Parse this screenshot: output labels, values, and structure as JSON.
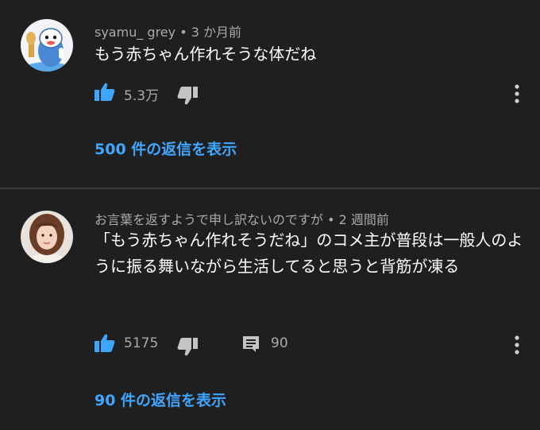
{
  "comments": [
    {
      "username": "syamu_ grey",
      "separator": "•",
      "time": "3 か月前",
      "text": "もう赤ちゃん作れそうな体だね",
      "like_count": "5.3万",
      "replies_label": "500 件の返信を表示",
      "avatar_icon": "cartoon-character-avatar",
      "accent_color": "#3ea6ff"
    },
    {
      "username": "お言葉を返すようで申し訳ないのですが",
      "separator": "•",
      "time": "2 週間前",
      "text": "「もう赤ちゃん作れそうだね」のコメ主が普段は一般人のように振る舞いながら生活してると思うと背筋が凍る",
      "like_count": "5175",
      "reply_count": "90",
      "replies_label": "90 件の返信を表示",
      "avatar_icon": "person-photo-avatar",
      "accent_color": "#3ea6ff"
    }
  ]
}
